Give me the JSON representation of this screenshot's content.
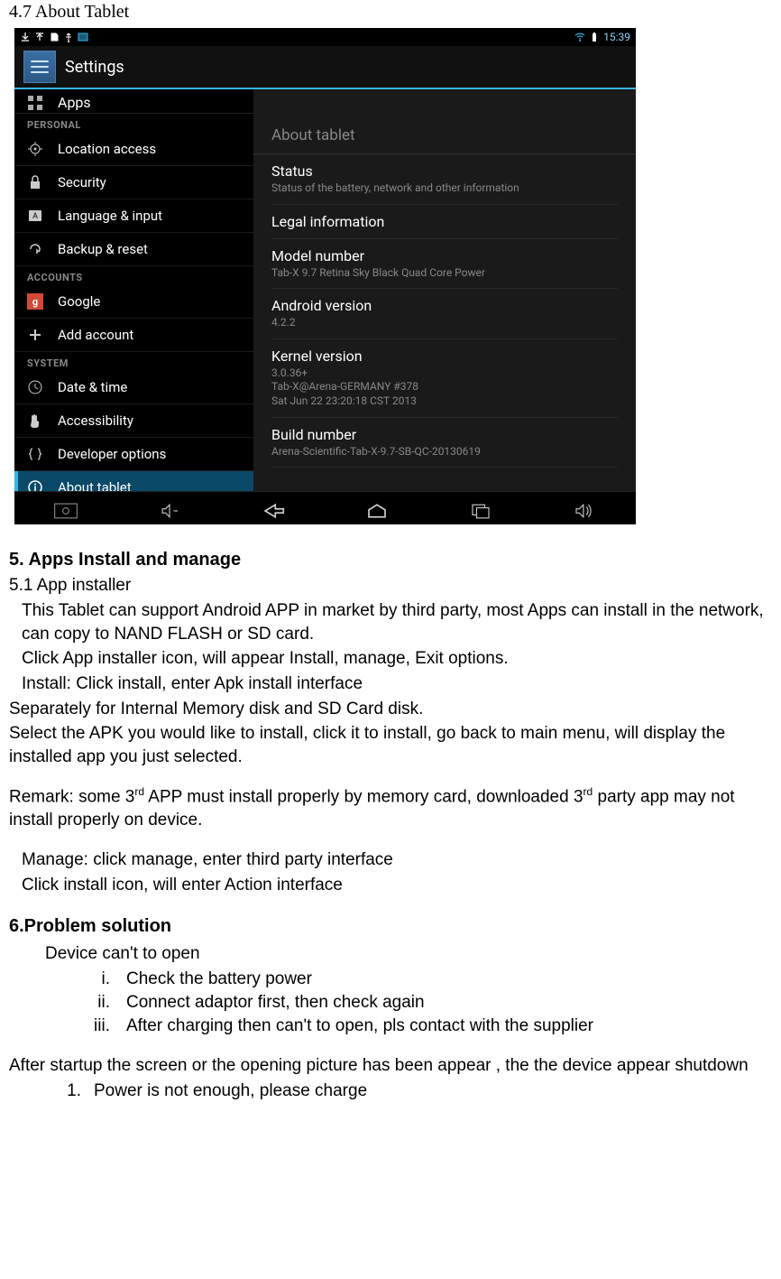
{
  "doc": {
    "section_title": "4.7 About Tablet",
    "section5_heading": "5. Apps Install and manage",
    "section5_1": "5.1 App installer",
    "p1": "This Tablet can support Android APP in market by third party, most Apps can install in the network, can copy to NAND FLASH or SD card.",
    "p2": "Click App installer icon, will appear Install, manage, Exit options.",
    "p3": "Install: Click install, enter Apk install interface",
    "p4": "Separately for Internal Memory disk and SD Card disk.",
    "p5": "Select the APK you would like to install, click it to install, go back to main menu, will display the installed app you just selected.",
    "remark_pre": "Remark: some 3",
    "remark_sup1": "rd",
    "remark_mid": " APP must install properly by memory card, downloaded 3",
    "remark_sup2": "rd",
    "remark_post": " party app may not install properly on device.",
    "p6": "Manage: click manage, enter third party interface",
    "p7": "Click install icon, will enter Action interface",
    "section6_heading": "6.Problem solution",
    "p8": "Device can't to open",
    "li_i": "Check the battery power",
    "li_ii": "Connect adaptor first, then check again",
    "li_iii": "After charging then can't to open, pls contact with the supplier",
    "p9": "After startup the screen or the opening picture has been appear , the the device appear shutdown",
    "li_1": "Power is not enough, please charge",
    "roman_i": "i.",
    "roman_ii": "ii.",
    "roman_iii": "iii.",
    "arabic_1": "1."
  },
  "ui": {
    "clock": "15:39",
    "settings_title": "Settings",
    "truncated_item": "Apps",
    "sections": {
      "personal": "PERSONAL",
      "accounts": "ACCOUNTS",
      "system": "SYSTEM"
    },
    "nav": {
      "location": "Location access",
      "security": "Security",
      "language": "Language & input",
      "backup": "Backup & reset",
      "google": "Google",
      "add_account": "Add account",
      "datetime": "Date & time",
      "accessibility": "Accessibility",
      "developer": "Developer options",
      "about": "About tablet"
    },
    "content_title": "About tablet",
    "rows": {
      "status_t": "Status",
      "status_s": "Status of the battery, network and other information",
      "legal_t": "Legal information",
      "model_t": "Model number",
      "model_s": "Tab-X 9.7 Retina Sky Black Quad Core Power",
      "android_t": "Android version",
      "android_s": "4.2.2",
      "kernel_t": "Kernel version",
      "kernel_s1": "3.0.36+",
      "kernel_s2": "Tab-X@Arena-GERMANY #378",
      "kernel_s3": "Sat Jun 22 23:20:18 CST 2013",
      "build_t": "Build number",
      "build_s": "Arena-Scientific-Tab-X-9.7-SB-QC-20130619"
    }
  }
}
